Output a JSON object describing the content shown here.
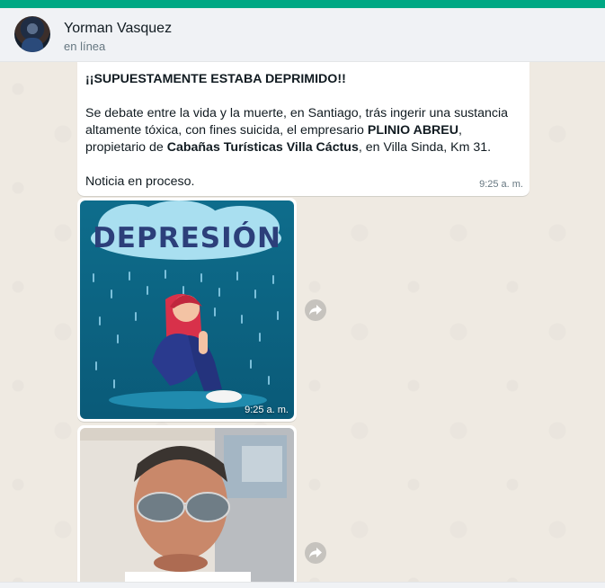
{
  "header": {
    "contact_name": "Yorman Vasquez",
    "contact_status": "en línea"
  },
  "messages": {
    "text_message": {
      "title": "¡¡SUPUESTAMENTE ESTABA DEPRIMIDO!!",
      "body_part1": "Se debate entre la vida y la muerte, en Santiago, trás ingerir una sustancia altamente tóxica, con fines suicida, el empresario ",
      "body_bold1": "PLINIO ABREU",
      "body_part2": ", propietario de ",
      "body_bold2": "Cabañas Turísticas Villa Cáctus",
      "body_part3": ", en Villa Sinda, Km 31.",
      "closing": "Noticia en proceso.",
      "time": "9:25 a. m."
    },
    "image_message_1": {
      "image_text": "DEPRESIÓN",
      "time": "9:25 a. m."
    },
    "image_message_2": {
      "description_icon": "photo-man-sunglasses"
    }
  },
  "colors": {
    "accent": "#00a884",
    "chat_bg": "#efeae2",
    "header_bg": "#f0f2f5",
    "bubble_bg": "#ffffff"
  }
}
